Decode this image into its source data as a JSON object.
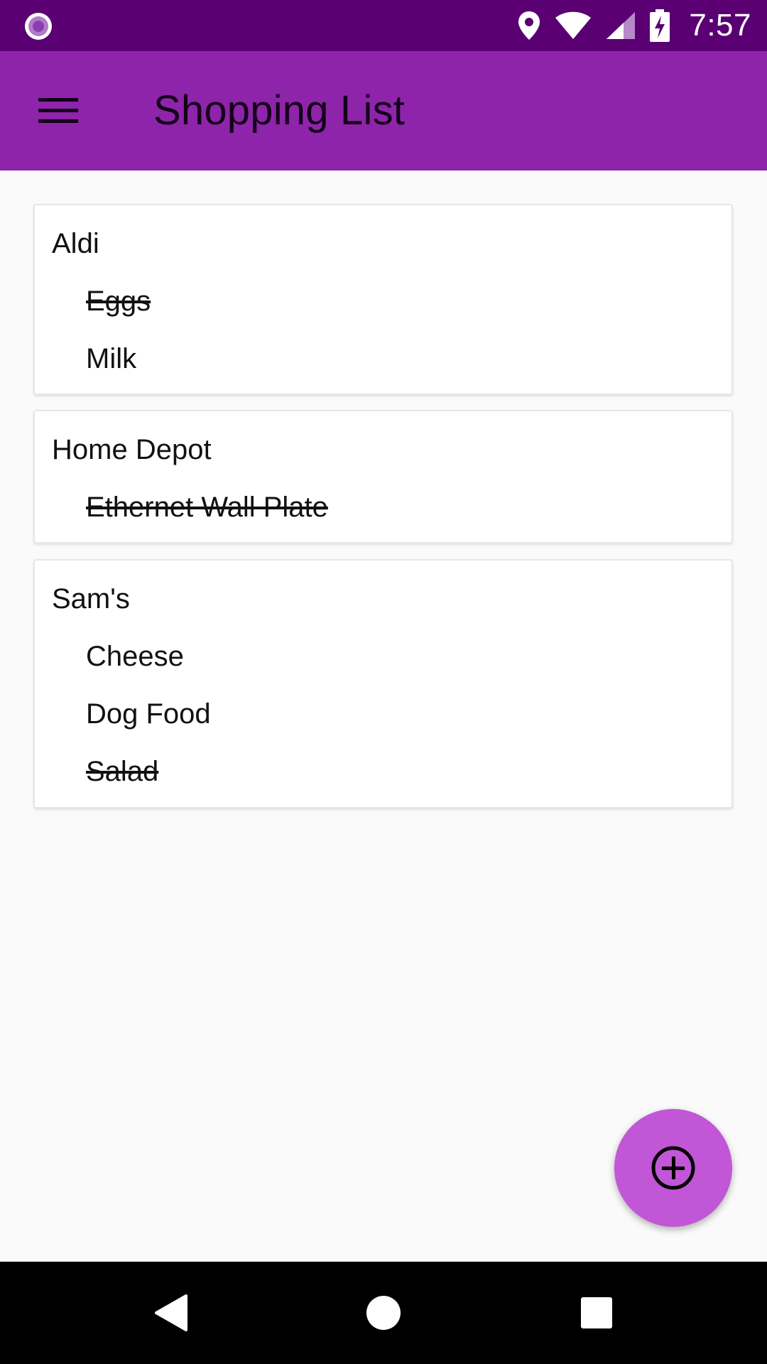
{
  "status_bar": {
    "time": "7:57",
    "icons": [
      "notification-dot-icon",
      "location-icon",
      "wifi-icon",
      "signal-icon",
      "battery-charging-icon"
    ],
    "background": "#5a0073"
  },
  "app_bar": {
    "title": "Shopping List",
    "menu_icon": "hamburger-menu-icon",
    "background": "#8e24aa"
  },
  "stores": [
    {
      "name": "Aldi",
      "items": [
        {
          "label": "Eggs",
          "done": true
        },
        {
          "label": "Milk",
          "done": false
        }
      ]
    },
    {
      "name": "Home Depot",
      "items": [
        {
          "label": "Ethernet Wall Plate",
          "done": true
        }
      ]
    },
    {
      "name": "Sam's",
      "items": [
        {
          "label": "Cheese",
          "done": false
        },
        {
          "label": "Dog Food",
          "done": false
        },
        {
          "label": "Salad",
          "done": true
        }
      ]
    }
  ],
  "fab": {
    "icon": "add-circle-icon",
    "color": "#c156d6"
  },
  "nav_bar": {
    "buttons": [
      "back-icon",
      "home-icon",
      "recents-icon"
    ]
  }
}
